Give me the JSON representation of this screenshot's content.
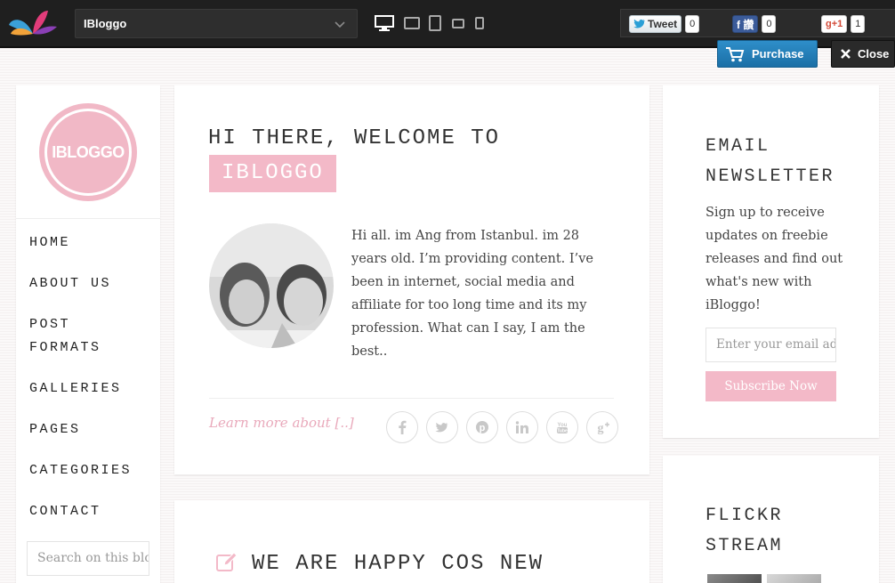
{
  "topbar": {
    "theme_name": "IBloggo",
    "devices": [
      "desktop-icon",
      "tablet-landscape-icon",
      "tablet-portrait-icon",
      "phone-landscape-icon",
      "phone-portrait-icon"
    ],
    "tweet_label": "Tweet",
    "tweet_count": "0",
    "facebook_label": "f 讚",
    "facebook_count": "0",
    "gplus_label": "g+1",
    "gplus_count": "1",
    "purchase_label": "Purchase",
    "close_label": "Close"
  },
  "left_sidebar": {
    "logo_text": "IBLOGGO",
    "nav": [
      "HOME",
      "ABOUT US",
      "POST FORMATS",
      "GALLERIES",
      "PAGES",
      "CATEGORIES",
      "CONTACT"
    ],
    "search_placeholder": "Search on this blog"
  },
  "post": {
    "title_line1": "HI THERE, WELCOME TO",
    "title_highlight": "IBLOGGO",
    "bio": "Hi all. im Ang from Istanbul. im 28 years old. I’m providing content. I’ve been in internet, social media and affiliate for too long time and its my profession. What can I say, I am the best..",
    "learn_more": "Learn more about [..]",
    "share_icons": [
      "facebook-icon",
      "twitter-icon",
      "pinterest-icon",
      "linkedin-icon",
      "youtube-icon",
      "google-plus-icon"
    ]
  },
  "post2": {
    "title": "WE ARE HAPPY COS NEW"
  },
  "newsletter": {
    "title_line1": "EMAIL",
    "title_line2": "NEWSLETTER",
    "text": "Sign up to receive updates on freebie releases and find out what's new with iBloggo!",
    "email_placeholder": "Enter your email address",
    "subscribe_label": "Subscribe Now"
  },
  "flickr": {
    "title_line1": "FLICKR",
    "title_line2": "STREAM"
  },
  "colors": {
    "accent_pink": "#f3b9c8",
    "topbar": "#1f1f1f",
    "purchase_blue": "#1b6fa6"
  }
}
